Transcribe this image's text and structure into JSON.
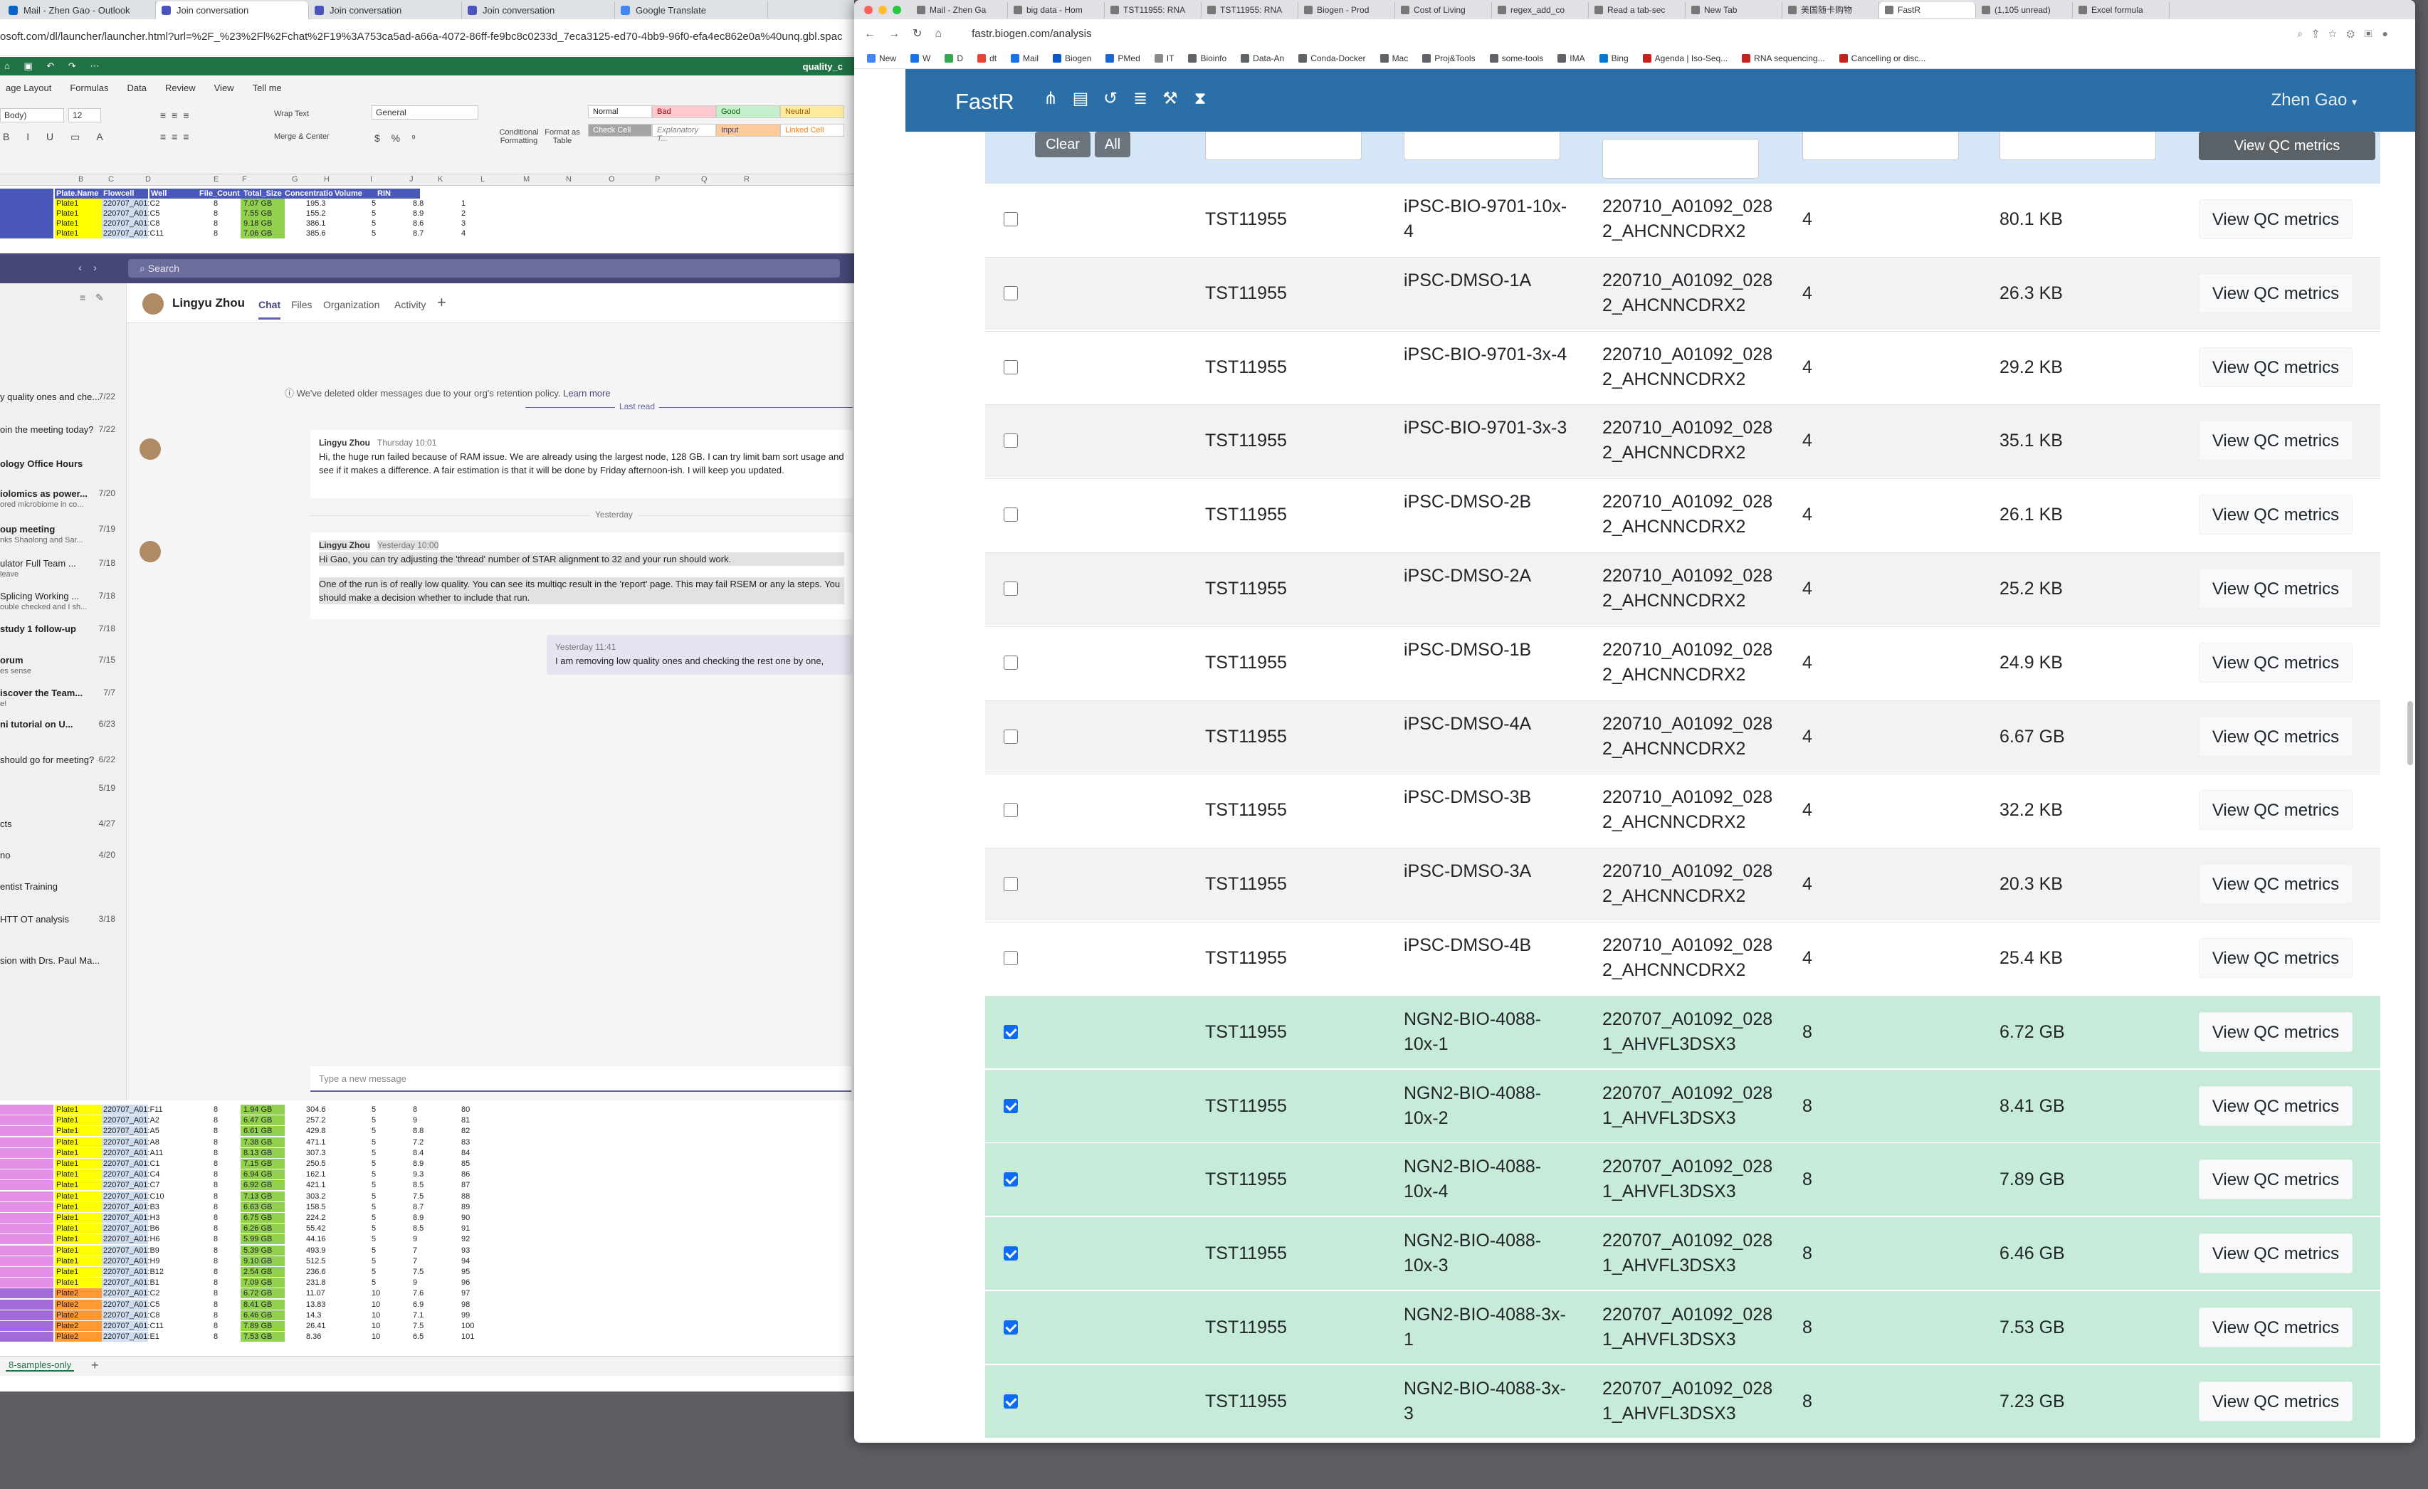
{
  "left_browser": {
    "tabs": [
      "Mail - Zhen Gao - Outlook",
      "Join conversation",
      "Join conversation",
      "Join conversation",
      "Google Translate"
    ],
    "address": "osoft.com/dl/launcher/launcher.html?url=%2F_%23%2Fl%2Fchat%2F19%3A753ca5ad-a66a-4072-86ff-fe9bc8c0233d_7eca3125-ed70-4bb9-96f0-efa4ec862e0a%40unq.gbl.spac"
  },
  "excel": {
    "filename": "quality_c",
    "menu": [
      "age Layout",
      "Formulas",
      "Data",
      "Review",
      "View",
      "Tell me"
    ],
    "font_name": "Body)",
    "font_size": "12",
    "wrap_text": "Wrap Text",
    "merge_center": "Merge & Center",
    "number_format": "General",
    "conditional_formatting": "Conditional Formatting",
    "format_as_table": "Format as Table",
    "styles": [
      "Normal",
      "Bad",
      "Good",
      "Neutral",
      "Check Cell",
      "Explanatory T...",
      "Input",
      "Linked Cell"
    ],
    "col_headers": [
      "B",
      "C",
      "D",
      "E",
      "F",
      "G",
      "H",
      "I",
      "J",
      "K",
      "L",
      "M",
      "N",
      "O",
      "P",
      "Q",
      "R"
    ],
    "header_row": [
      "Plate.Name",
      "Flowcell",
      "Well",
      "File_Count",
      "Total_Size",
      "Concentratio",
      "Volume",
      "RIN"
    ],
    "top_rows": [
      [
        "Plate1",
        "220707_A01:C2",
        "8",
        "7.07 GB",
        "195.3",
        "5",
        "8.8",
        "1"
      ],
      [
        "Plate1",
        "220707_A01:C5",
        "8",
        "7.55 GB",
        "155.2",
        "5",
        "8.9",
        "2"
      ],
      [
        "Plate1",
        "220707_A01:C8",
        "8",
        "9.18 GB",
        "386.1",
        "5",
        "8.6",
        "3"
      ],
      [
        "Plate1",
        "220707_A01:C11",
        "8",
        "7.06 GB",
        "385.6",
        "5",
        "8.7",
        "4"
      ]
    ],
    "bottom_rows": [
      [
        "Plate1",
        "220707_A01:F11",
        "8",
        "1.94 GB",
        "304.6",
        "5",
        "8",
        "80"
      ],
      [
        "Plate1",
        "220707_A01:A2",
        "8",
        "6.47 GB",
        "257.2",
        "5",
        "9",
        "81"
      ],
      [
        "Plate1",
        "220707_A01:A5",
        "8",
        "6.61 GB",
        "429.8",
        "5",
        "8.8",
        "82"
      ],
      [
        "Plate1",
        "220707_A01:A8",
        "8",
        "7.38 GB",
        "471.1",
        "5",
        "7.2",
        "83"
      ],
      [
        "Plate1",
        "220707_A01:A11",
        "8",
        "8.13 GB",
        "307.3",
        "5",
        "8.4",
        "84"
      ],
      [
        "Plate1",
        "220707_A01:C1",
        "8",
        "7.15 GB",
        "250.5",
        "5",
        "8.9",
        "85"
      ],
      [
        "Plate1",
        "220707_A01:C4",
        "8",
        "6.94 GB",
        "162.1",
        "5",
        "9.3",
        "86"
      ],
      [
        "Plate1",
        "220707_A01:C7",
        "8",
        "6.92 GB",
        "421.1",
        "5",
        "8.5",
        "87"
      ],
      [
        "Plate1",
        "220707_A01:C10",
        "8",
        "7.13 GB",
        "303.2",
        "5",
        "7.5",
        "88"
      ],
      [
        "Plate1",
        "220707_A01:B3",
        "8",
        "6.63 GB",
        "158.5",
        "5",
        "8.7",
        "89"
      ],
      [
        "Plate1",
        "220707_A01:H3",
        "8",
        "6.75 GB",
        "224.2",
        "5",
        "8.9",
        "90"
      ],
      [
        "Plate1",
        "220707_A01:B6",
        "8",
        "6.26 GB",
        "55.42",
        "5",
        "8.5",
        "91"
      ],
      [
        "Plate1",
        "220707_A01:H6",
        "8",
        "5.99 GB",
        "44.16",
        "5",
        "9",
        "92"
      ],
      [
        "Plate1",
        "220707_A01:B9",
        "8",
        "5.39 GB",
        "493.9",
        "5",
        "7",
        "93"
      ],
      [
        "Plate1",
        "220707_A01:H9",
        "8",
        "9.10 GB",
        "512.5",
        "5",
        "7",
        "94"
      ],
      [
        "Plate1",
        "220707_A01:B12",
        "8",
        "2.54 GB",
        "236.6",
        "5",
        "7.5",
        "95"
      ],
      [
        "Plate1",
        "220707_A01:B1",
        "8",
        "7.09 GB",
        "231.8",
        "5",
        "9",
        "96"
      ],
      [
        "Plate2",
        "220707_A01:C2",
        "8",
        "6.72 GB",
        "11.07",
        "10",
        "7.6",
        "97"
      ],
      [
        "Plate2",
        "220707_A01:C5",
        "8",
        "8.41 GB",
        "13.83",
        "10",
        "6.9",
        "98"
      ],
      [
        "Plate2",
        "220707_A01:C8",
        "8",
        "6.46 GB",
        "14.3",
        "10",
        "7.1",
        "99"
      ],
      [
        "Plate2",
        "220707_A01:C11",
        "8",
        "7.89 GB",
        "26.41",
        "10",
        "7.5",
        "100"
      ],
      [
        "Plate2",
        "220707_A01:E1",
        "8",
        "7.53 GB",
        "8.36",
        "10",
        "6.5",
        "101"
      ]
    ],
    "sheet_tab": "8-samples-only"
  },
  "teams": {
    "search_placeholder": "Search",
    "contact_name": "Lingyu Zhou",
    "tabs": [
      "Chat",
      "Files",
      "Organization",
      "Activity"
    ],
    "sidebar": [
      {
        "title": "y quality ones and che...",
        "date": "7/22",
        "bold": false
      },
      {
        "title": "oin the meeting today?",
        "date": "7/22",
        "bold": false
      },
      {
        "title": "ology Office Hours",
        "date": "",
        "bold": true
      },
      {
        "title": "iolomics as power...",
        "sub": "ored microbiome in co...",
        "date": "7/20",
        "bold": true
      },
      {
        "title": "oup meeting",
        "sub": "nks Shaolong and Sar...",
        "date": "7/19",
        "bold": true
      },
      {
        "title": "ulator Full Team ...",
        "sub": "leave",
        "date": "7/18",
        "bold": false
      },
      {
        "title": "Splicing Working ...",
        "sub": "ouble checked and I sh...",
        "date": "7/18",
        "bold": false
      },
      {
        "title": "study 1 follow-up",
        "date": "7/18",
        "bold": true
      },
      {
        "title": "orum",
        "sub": "es sense",
        "date": "7/15",
        "bold": true
      },
      {
        "title": "iscover the Team...",
        "sub": "e!",
        "date": "7/7",
        "bold": true
      },
      {
        "title": "ni tutorial on U...",
        "date": "6/23",
        "bold": true
      },
      {
        "title": "should go for meeting?",
        "date": "6/22",
        "bold": false
      },
      {
        "title": "",
        "date": "5/19",
        "bold": false
      },
      {
        "title": "cts",
        "date": "4/27",
        "bold": false
      },
      {
        "title": "no",
        "date": "4/20",
        "bold": false
      },
      {
        "title": "entist Training",
        "date": "",
        "bold": false
      },
      {
        "title": "HTT OT analysis",
        "date": "3/18",
        "bold": false
      },
      {
        "title": "sion with Drs. Paul Ma...",
        "date": "",
        "bold": false
      }
    ],
    "retention_notice": "We've deleted older messages due to your org's retention policy.",
    "learn_more": "Learn more",
    "last_read": "Last read",
    "msg1": {
      "author": "Lingyu Zhou",
      "time": "Thursday 10:01",
      "text": "Hi, the huge run failed because of RAM issue. We are already using the largest node, 128 GB. I can try limit bam sort usage and see if it makes a difference. A fair estimation is that it will be done by Friday afternoon-ish. I will keep you updated."
    },
    "yesterday": "Yesterday",
    "msg2": {
      "author": "Lingyu Zhou",
      "time": "Yesterday 10:00",
      "text1": "Hi Gao, you can try adjusting the 'thread' number of STAR alignment to 32 and your run should work.",
      "text2": "One of the run is of really low quality. You can see its multiqc result in the 'report' page. This may fail RSEM or any la steps. You should make a decision whether to include that run."
    },
    "msg3": {
      "time": "Yesterday 11:41",
      "text": "I am removing low quality ones and checking the rest one by one,"
    },
    "composer_placeholder": "Type a new message"
  },
  "right_browser": {
    "tabs": [
      "Mail - Zhen Ga",
      "big data - Hom",
      "TST11955: RNA",
      "TST11955: RNA",
      "Biogen - Prod",
      "Cost of Living",
      "regex_add_co",
      "Read a tab-sec",
      "New Tab",
      "美国随卡购物",
      "FastR",
      "(1,105 unread)",
      "Excel formula"
    ],
    "active_tab": "FastR",
    "url": "fastr.biogen.com/analysis",
    "bookmarks": [
      "New",
      "W",
      "D",
      "dt",
      "Mail",
      "Biogen",
      "PMed",
      "IT",
      "Bioinfo",
      "Data-An",
      "Conda-Docker",
      "Mac",
      "Proj&Tools",
      "some-tools",
      "IMA",
      "Bing",
      "Agenda | Iso-Seq...",
      "RNA sequencing...",
      "Cancelling or disc..."
    ]
  },
  "fastr": {
    "brand": "FastR",
    "user": "Zhen Gao",
    "nav_icons": [
      "workflow-icon",
      "file-icon",
      "history-icon",
      "database-icon",
      "wrench-icon",
      "hourglass-icon"
    ],
    "clear_label": "Clear",
    "all_label": "All",
    "header_qc_label": "View QC metrics",
    "qc_label": "View QC metrics",
    "rows": [
      {
        "project": "TST11955",
        "sample": "iPSC-BIO-9701-10x-4",
        "flowcell": "220710_A01092_0282_AHCNNCDRX2",
        "lanes": "4",
        "size": "80.1 KB",
        "selected": false
      },
      {
        "project": "TST11955",
        "sample": "iPSC-DMSO-1A",
        "flowcell": "220710_A01092_0282_AHCNNCDRX2",
        "lanes": "4",
        "size": "26.3 KB",
        "selected": false
      },
      {
        "project": "TST11955",
        "sample": "iPSC-BIO-9701-3x-4",
        "flowcell": "220710_A01092_0282_AHCNNCDRX2",
        "lanes": "4",
        "size": "29.2 KB",
        "selected": false
      },
      {
        "project": "TST11955",
        "sample": "iPSC-BIO-9701-3x-3",
        "flowcell": "220710_A01092_0282_AHCNNCDRX2",
        "lanes": "4",
        "size": "35.1 KB",
        "selected": false
      },
      {
        "project": "TST11955",
        "sample": "iPSC-DMSO-2B",
        "flowcell": "220710_A01092_0282_AHCNNCDRX2",
        "lanes": "4",
        "size": "26.1 KB",
        "selected": false
      },
      {
        "project": "TST11955",
        "sample": "iPSC-DMSO-2A",
        "flowcell": "220710_A01092_0282_AHCNNCDRX2",
        "lanes": "4",
        "size": "25.2 KB",
        "selected": false
      },
      {
        "project": "TST11955",
        "sample": "iPSC-DMSO-1B",
        "flowcell": "220710_A01092_0282_AHCNNCDRX2",
        "lanes": "4",
        "size": "24.9 KB",
        "selected": false
      },
      {
        "project": "TST11955",
        "sample": "iPSC-DMSO-4A",
        "flowcell": "220710_A01092_0282_AHCNNCDRX2",
        "lanes": "4",
        "size": "6.67 GB",
        "selected": false
      },
      {
        "project": "TST11955",
        "sample": "iPSC-DMSO-3B",
        "flowcell": "220710_A01092_0282_AHCNNCDRX2",
        "lanes": "4",
        "size": "32.2 KB",
        "selected": false
      },
      {
        "project": "TST11955",
        "sample": "iPSC-DMSO-3A",
        "flowcell": "220710_A01092_0282_AHCNNCDRX2",
        "lanes": "4",
        "size": "20.3 KB",
        "selected": false
      },
      {
        "project": "TST11955",
        "sample": "iPSC-DMSO-4B",
        "flowcell": "220710_A01092_0282_AHCNNCDRX2",
        "lanes": "4",
        "size": "25.4 KB",
        "selected": false
      },
      {
        "project": "TST11955",
        "sample": "NGN2-BIO-4088-10x-1",
        "flowcell": "220707_A01092_0281_AHVFL3DSX3",
        "lanes": "8",
        "size": "6.72 GB",
        "selected": true
      },
      {
        "project": "TST11955",
        "sample": "NGN2-BIO-4088-10x-2",
        "flowcell": "220707_A01092_0281_AHVFL3DSX3",
        "lanes": "8",
        "size": "8.41 GB",
        "selected": true
      },
      {
        "project": "TST11955",
        "sample": "NGN2-BIO-4088-10x-4",
        "flowcell": "220707_A01092_0281_AHVFL3DSX3",
        "lanes": "8",
        "size": "7.89 GB",
        "selected": true
      },
      {
        "project": "TST11955",
        "sample": "NGN2-BIO-4088-10x-3",
        "flowcell": "220707_A01092_0281_AHVFL3DSX3",
        "lanes": "8",
        "size": "6.46 GB",
        "selected": true
      },
      {
        "project": "TST11955",
        "sample": "NGN2-BIO-4088-3x-1",
        "flowcell": "220707_A01092_0281_AHVFL3DSX3",
        "lanes": "8",
        "size": "7.53 GB",
        "selected": true
      },
      {
        "project": "TST11955",
        "sample": "NGN2-BIO-4088-3x-3",
        "flowcell": "220707_A01092_0281_AHVFL3DSX3",
        "lanes": "8",
        "size": "7.23 GB",
        "selected": true
      }
    ]
  },
  "colors": {
    "fastr_nav": "#2a6fa8",
    "selected_row": "#c6ebd8",
    "excel_green": "#217346",
    "teams_purple": "#464775"
  }
}
